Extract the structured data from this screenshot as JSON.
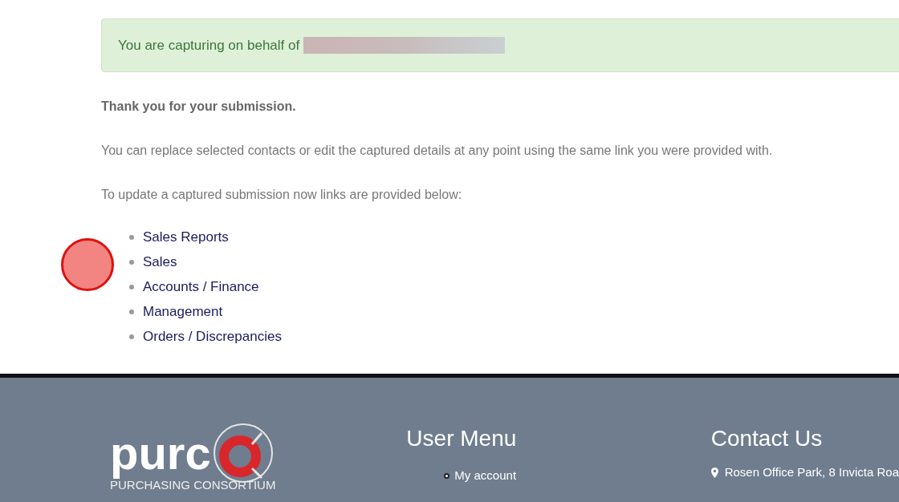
{
  "alert": {
    "text": "You are capturing on behalf of",
    "redacted": true
  },
  "heading": "Thank you for your submission.",
  "paragraphs": [
    "You can replace selected contacts or edit the captured details at any point using the same link you were provided with.",
    "To update a captured submission now links are provided below:"
  ],
  "links": [
    "Sales Reports",
    "Sales",
    "Accounts / Finance",
    "Management",
    "Orders / Discrepancies"
  ],
  "click_marker": {
    "shown": true
  },
  "footer": {
    "logo": {
      "word": "purc",
      "tagline": "PURCHASING CONSORTIUM"
    },
    "user_menu": {
      "title": "User Menu",
      "items": [
        "My account"
      ]
    },
    "contact": {
      "title": "Contact Us",
      "address": "Rosen Office Park, 8 Invicta Roa"
    }
  }
}
